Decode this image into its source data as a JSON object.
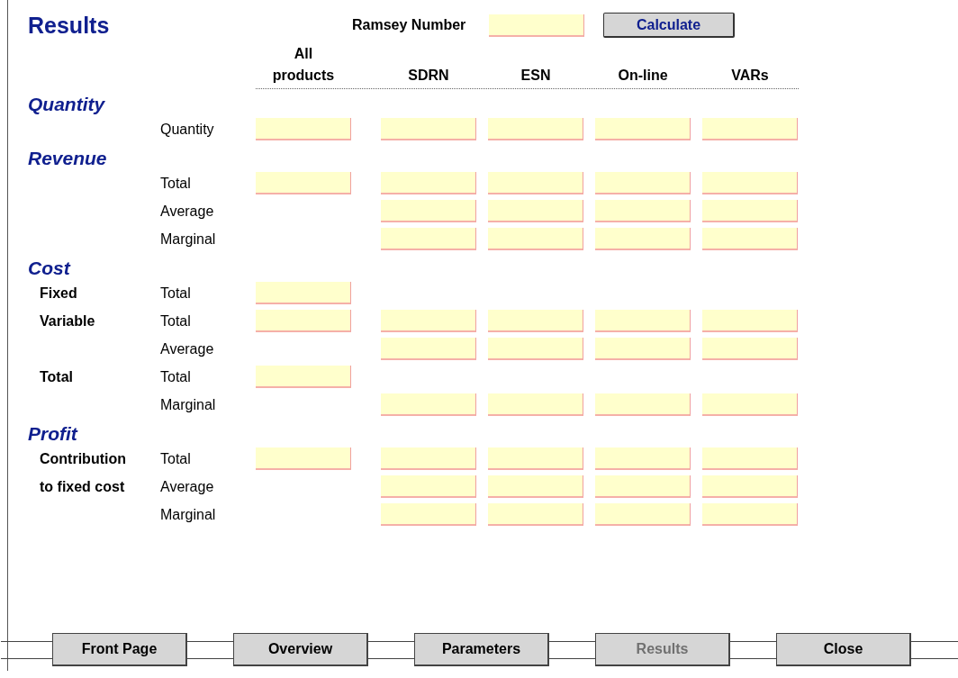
{
  "title": "Results",
  "ramsey": {
    "label": "Ramsey Number"
  },
  "calculate_button": "Calculate",
  "columns": [
    "All products",
    "SDRN",
    "ESN",
    "On-line",
    "VARs"
  ],
  "sections": [
    {
      "title": "Quantity",
      "rows": [
        {
          "label": "Quantity",
          "all": true,
          "split": true
        }
      ]
    },
    {
      "title": "Revenue",
      "rows": [
        {
          "label": "Total",
          "all": true,
          "split": true
        },
        {
          "label": "Average",
          "all": false,
          "split": true
        },
        {
          "label": "Marginal",
          "all": false,
          "split": true
        }
      ]
    },
    {
      "title": "Cost",
      "rows": [
        {
          "group": "Fixed",
          "label": "Total",
          "all": true,
          "split": false
        },
        {
          "group": "Variable",
          "label": "Total",
          "all": true,
          "split": true
        },
        {
          "label": "Average",
          "all": false,
          "split": true
        },
        {
          "group": "Total",
          "label": "Total",
          "all": true,
          "split": false
        },
        {
          "label": "Marginal",
          "all": false,
          "split": true
        }
      ]
    },
    {
      "title": "Profit",
      "rows": [
        {
          "group": "Contribution",
          "label": "Total",
          "all": true,
          "split": true
        },
        {
          "group": "to fixed cost",
          "label": "Average",
          "all": false,
          "split": true
        },
        {
          "label": "Marginal",
          "all": false,
          "split": true
        }
      ]
    }
  ],
  "nav": [
    {
      "label": "Front Page",
      "disabled": false
    },
    {
      "label": "Overview",
      "disabled": false
    },
    {
      "label": "Parameters",
      "disabled": false
    },
    {
      "label": "Results",
      "disabled": true
    },
    {
      "label": "Close",
      "disabled": false
    }
  ]
}
